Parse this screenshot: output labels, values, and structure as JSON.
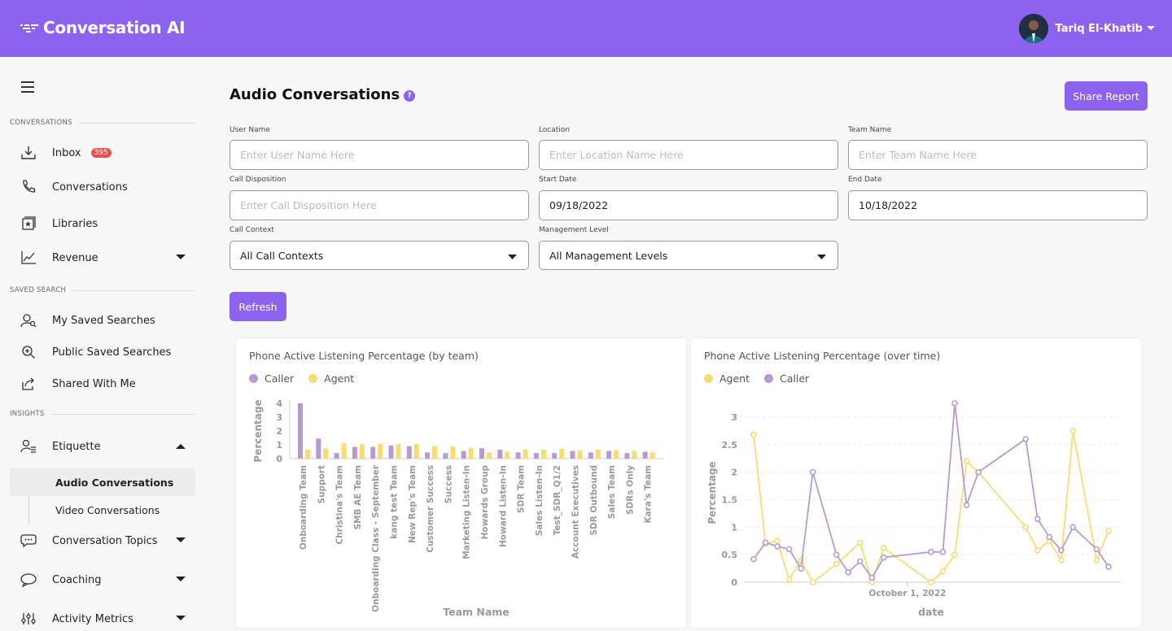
{
  "header": {
    "app_name": "Conversation AI",
    "user_name": "Tariq El-Khatib"
  },
  "sidebar": {
    "sections": {
      "conversations": "CONVERSATIONS",
      "saved_search": "SAVED SEARCH",
      "insights": "INSIGHTS"
    },
    "items": {
      "inbox": "Inbox",
      "inbox_badge": "395",
      "conversations": "Conversations",
      "libraries": "Libraries",
      "revenue": "Revenue",
      "my_saved": "My Saved Searches",
      "public_saved": "Public Saved Searches",
      "shared": "Shared With Me",
      "etiquette": "Etiquette",
      "audio": "Audio Conversations",
      "video": "Video Conversations",
      "topics": "Conversation Topics",
      "coaching": "Coaching",
      "activity": "Activity Metrics"
    }
  },
  "main": {
    "title": "Audio Conversations",
    "help": "?",
    "share_label": "Share Report",
    "refresh_label": "Refresh",
    "filters": {
      "user_name": {
        "label": "User Name",
        "placeholder": "Enter User Name Here"
      },
      "location": {
        "label": "Location",
        "placeholder": "Enter Location Name Here"
      },
      "team_name": {
        "label": "Team Name",
        "placeholder": "Enter Team Name Here"
      },
      "disposition": {
        "label": "Call Disposition",
        "placeholder": "Enter Call Disposition Here"
      },
      "start_date": {
        "label": "Start Date",
        "value": "09/18/2022"
      },
      "end_date": {
        "label": "End Date",
        "value": "10/18/2022"
      },
      "call_context": {
        "label": "Call Context",
        "value": "All Call Contexts"
      },
      "management": {
        "label": "Management Level",
        "value": "All Management Levels"
      }
    }
  },
  "colors": {
    "accent": "#8b63ef",
    "caller": "#b79bd0",
    "agent": "#f7dc6f",
    "badge": "#f04f4f"
  },
  "chart_data": [
    {
      "type": "bar",
      "title": "Phone Active Listening Percentage (by team)",
      "xlabel": "Team Name",
      "ylabel": "Percentage",
      "ylim": [
        0,
        4
      ],
      "yticks": [
        "0",
        "1",
        "2",
        "3",
        "4"
      ],
      "grid": false,
      "legend_position": "top-left",
      "categories": [
        "Onboarding Team",
        "Support",
        "Christina's Team",
        "SMB AE Team",
        "Onboarding Class - September",
        "kang test Team",
        "New Rep's Team",
        "Customer Success",
        "Success",
        "Marketing Listen-In",
        "Howards Group",
        "Howard Listen-In",
        "SDR Team",
        "Sales Listen-In",
        "Test_SDR_Q1/2",
        "Account Executives",
        "SDR Outbound",
        "Sales Team",
        "SDRs Only",
        "Kara's Team"
      ],
      "series": [
        {
          "name": "Caller",
          "values": [
            4.0,
            1.45,
            0.4,
            0.85,
            0.85,
            0.95,
            0.9,
            0.45,
            0.4,
            0.55,
            0.75,
            0.65,
            0.45,
            0.4,
            0.4,
            0.55,
            0.45,
            0.55,
            0.4,
            0.5
          ]
        },
        {
          "name": "Agent",
          "values": [
            0.65,
            0.75,
            1.1,
            1.05,
            1.05,
            1.05,
            1.05,
            0.9,
            0.9,
            0.8,
            0.45,
            0.5,
            0.65,
            0.65,
            0.7,
            0.6,
            0.65,
            0.6,
            0.55,
            0.45
          ]
        }
      ]
    },
    {
      "type": "line",
      "title": "Phone Active Listening Percentage (over time)",
      "xlabel": "date",
      "ylabel": "Percentage",
      "xtick": "October 1, 2022",
      "ylim": [
        0,
        3.25
      ],
      "yticks": [
        "0",
        "0.5",
        "1",
        "1.5",
        "2",
        "2.5",
        "3"
      ],
      "grid": true,
      "legend_position": "top-left",
      "x": [
        "2022-09-18",
        "2022-09-19",
        "2022-09-20",
        "2022-09-21",
        "2022-09-22",
        "2022-09-23",
        "2022-09-24",
        "2022-09-25",
        "2022-09-26",
        "2022-09-27",
        "2022-09-28",
        "2022-09-29",
        "2022-10-03",
        "2022-10-04",
        "2022-10-05",
        "2022-10-06",
        "2022-10-07",
        "2022-10-08",
        "2022-10-11",
        "2022-10-12",
        "2022-10-13",
        "2022-10-14",
        "2022-10-15",
        "2022-10-17",
        "2022-10-18"
      ],
      "series": [
        {
          "name": "Agent",
          "values": [
            2.68,
            0.7,
            0.75,
            0.05,
            0.4,
            0.0,
            null,
            0.33,
            null,
            0.72,
            0.0,
            0.62,
            0.0,
            0.2,
            0.5,
            2.2,
            2.0,
            null,
            1.0,
            0.58,
            0.75,
            0.4,
            2.75,
            0.4,
            0.93
          ]
        },
        {
          "name": "Caller",
          "values": [
            0.42,
            0.72,
            0.65,
            0.6,
            0.25,
            2.0,
            null,
            0.5,
            0.18,
            0.38,
            0.08,
            0.45,
            0.55,
            0.55,
            3.25,
            1.4,
            2.0,
            null,
            2.6,
            1.15,
            0.82,
            0.58,
            1.0,
            0.6,
            0.28
          ]
        }
      ]
    }
  ]
}
